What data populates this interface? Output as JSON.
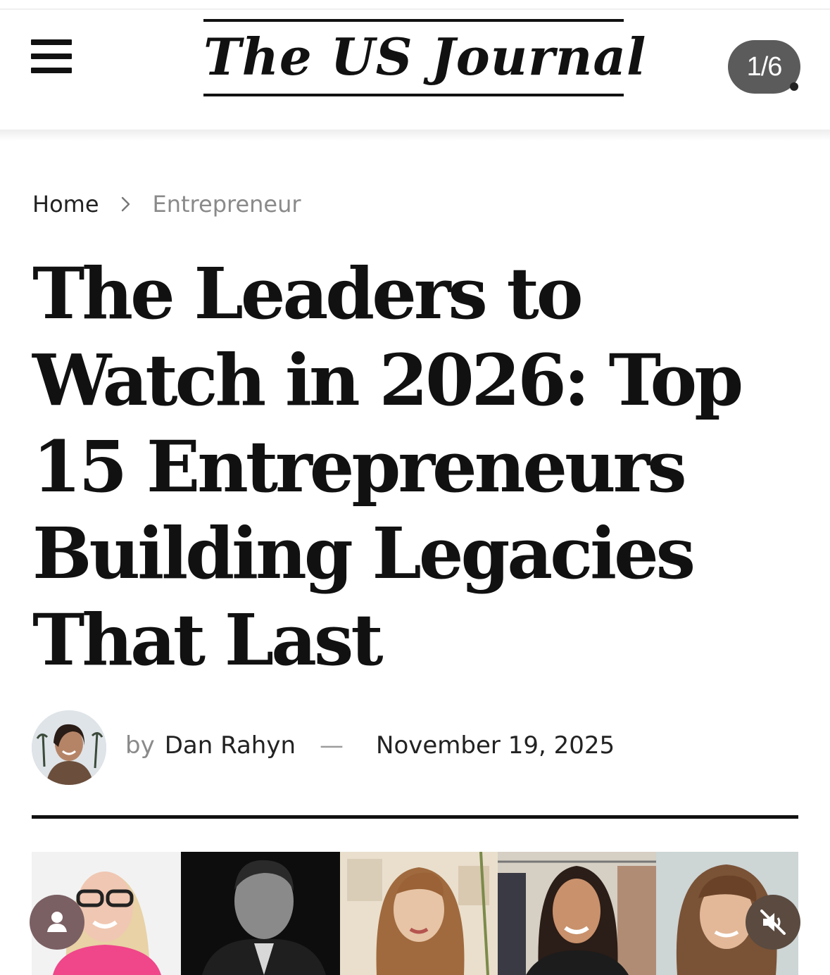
{
  "header": {
    "logo_text": "The US Journal",
    "page_counter": "1/6"
  },
  "breadcrumb": {
    "home": "Home",
    "current": "Entrepreneur"
  },
  "article": {
    "title": "The Leaders to Watch in 2026: Top 15 Entrepreneurs Building Legacies That Last",
    "by_label": "by",
    "author": "Dan Rahyn",
    "separator": "—",
    "date": "November 19, 2025"
  },
  "icons": {
    "menu": "hamburger-menu-icon",
    "breadcrumb_separator": "chevron-right-icon",
    "user": "user-icon",
    "mute": "speaker-muted-icon"
  },
  "colors": {
    "badge_bg": "#5b5b5b",
    "muted_text": "#8a8a8a",
    "user_fab": "#7a5f63",
    "mute_fab": "#5a4a40"
  }
}
